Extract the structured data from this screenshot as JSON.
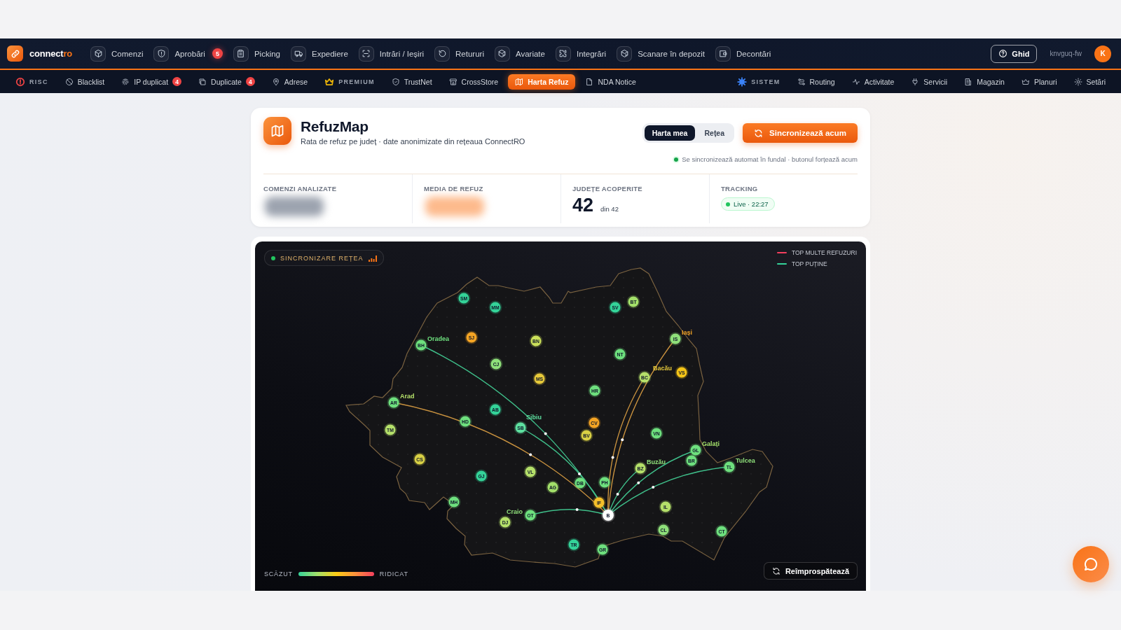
{
  "nav": {
    "brand": {
      "name": "connect",
      "accent": "ro"
    },
    "items": [
      {
        "label": "Comenzi"
      },
      {
        "label": "Aprobări",
        "badge": "5"
      },
      {
        "label": "Picking"
      },
      {
        "label": "Expediere"
      },
      {
        "label": "Intrări / Ieșiri"
      },
      {
        "label": "Retururi"
      },
      {
        "label": "Avariate"
      },
      {
        "label": "Integrări"
      },
      {
        "label": "Scanare în depozit"
      },
      {
        "label": "Decontări"
      }
    ],
    "help": "Ghid",
    "user": "knvguq-fw",
    "avatar": "K"
  },
  "subnav": {
    "left": [
      {
        "label": "RISC",
        "kind": "section",
        "color": "#ef4444"
      },
      {
        "label": "Blacklist",
        "kind": "link",
        "selected": false
      },
      {
        "label": "IP duplicat",
        "kind": "link",
        "badge": "4",
        "selected": false
      },
      {
        "label": "Duplicate",
        "kind": "link",
        "badge": "4",
        "selected": false
      },
      {
        "label": "Adrese",
        "kind": "link",
        "selected": false
      },
      {
        "label": "PREMIUM",
        "kind": "section",
        "color": "#eab308"
      },
      {
        "label": "TrustNet",
        "kind": "link",
        "selected": false
      },
      {
        "label": "CrossStore",
        "kind": "link",
        "selected": false
      },
      {
        "label": "Harta Refuz",
        "kind": "link",
        "selected": true
      },
      {
        "label": "NDA Notice",
        "kind": "link",
        "selected": false
      }
    ],
    "right": [
      {
        "label": "SISTEM",
        "kind": "section",
        "color": "#3b82f6"
      },
      {
        "label": "Routing",
        "kind": "link",
        "selected": false
      },
      {
        "label": "Activitate",
        "kind": "link",
        "selected": false
      },
      {
        "label": "Servicii",
        "kind": "link",
        "selected": false
      },
      {
        "label": "Magazin",
        "kind": "link",
        "selected": false
      },
      {
        "label": "Planuri",
        "kind": "link",
        "selected": false
      },
      {
        "label": "Setări",
        "kind": "link",
        "selected": false
      }
    ]
  },
  "header": {
    "title": "RefuzMap",
    "subtitle": "Rata de refuz pe județ · date anonimizate din rețeaua ConnectRO",
    "view_toggle": [
      {
        "label": "Harta mea",
        "selected": true
      },
      {
        "label": "Rețea",
        "selected": false
      }
    ],
    "sync_button": "Sincronizează acum",
    "sync_note": "Se sincronizează automat în fundal · butonul forțează acum"
  },
  "stats": [
    {
      "label": "COMENZI ANALIZATE",
      "kind": "blurred",
      "color": "#9ca3af"
    },
    {
      "label": "MEDIA DE REFUZ",
      "kind": "blurred",
      "color": "#fdba8c"
    },
    {
      "label": "JUDEȚE ACOPERITE",
      "kind": "number",
      "value": "42",
      "suffix": "din 42"
    },
    {
      "label": "TRACKING",
      "kind": "live",
      "value": "Live · 22:27"
    }
  ],
  "map": {
    "sync_chip": "SINCRONIZARE REȚEA",
    "legend": [
      {
        "label": "TOP MULTE REFUZURI",
        "color": "#f43f5e"
      },
      {
        "label": "TOP PUȚINE",
        "color": "#34d399"
      }
    ],
    "scale": {
      "low": "SCĂZUT",
      "high": "RIDICAT"
    },
    "refresh_button": "Reîmprospătează",
    "counties": [
      {
        "code": "SM",
        "color": "#34d399"
      },
      {
        "code": "MM",
        "color": "#34d399"
      },
      {
        "code": "SV",
        "color": "#34d399"
      },
      {
        "code": "BT",
        "color": "#a3e06a"
      },
      {
        "code": "BH",
        "color": "#6ee07e",
        "route": {
          "color": "#3fbf8a"
        },
        "label": {
          "text": "Oradea",
          "color": "#6ee07e"
        }
      },
      {
        "code": "SJ",
        "color": "#f5a524"
      },
      {
        "code": "BN",
        "color": "#cbe05a"
      },
      {
        "code": "IS",
        "color": "#8fe07a",
        "route": {
          "color": "#c9923f"
        },
        "label": {
          "text": "Iași",
          "color": "#f5a524"
        }
      },
      {
        "code": "CJ",
        "color": "#8fe07a"
      },
      {
        "code": "NT",
        "color": "#6ee07e"
      },
      {
        "code": "MS",
        "color": "#e6c93a"
      },
      {
        "code": "BC",
        "color": "#b5e06a",
        "route": {
          "color": "#c9923f"
        },
        "label": {
          "text": "Bacău",
          "color": "#e6c93a"
        }
      },
      {
        "code": "VS",
        "color": "#f5c518"
      },
      {
        "code": "HR",
        "color": "#6ee07e"
      },
      {
        "code": "AR",
        "color": "#6ee07e",
        "route": {
          "color": "#c9923f"
        },
        "label": {
          "text": "Arad",
          "color": "#b5e06a"
        }
      },
      {
        "code": "AB",
        "color": "#34d399"
      },
      {
        "code": "TM",
        "color": "#b5e06a"
      },
      {
        "code": "HD",
        "color": "#6ee07e"
      },
      {
        "code": "SB",
        "color": "#5ee0a0",
        "route": {
          "color": "#3fbf8a"
        },
        "label": {
          "text": "Sibiu",
          "color": "#5ee0a0"
        }
      },
      {
        "code": "BV",
        "color": "#d8d045"
      },
      {
        "code": "CV",
        "color": "#f5a524"
      },
      {
        "code": "VN",
        "color": "#6ee07e"
      },
      {
        "code": "GL",
        "color": "#6ee07e",
        "route": {
          "color": "#3fbf8a"
        },
        "label": {
          "text": "Galați",
          "color": "#a3e06a"
        }
      },
      {
        "code": "CS",
        "color": "#d8d045"
      },
      {
        "code": "BZ",
        "color": "#b5e06a",
        "route": {
          "color": "#3fbf8a"
        },
        "label": {
          "text": "Buzău",
          "color": "#8fe07a"
        }
      },
      {
        "code": "BR",
        "color": "#6ee07e"
      },
      {
        "code": "TL",
        "color": "#6ee07e",
        "route": {
          "color": "#3fbf8a"
        },
        "label": {
          "text": "Tulcea",
          "color": "#8fe07a"
        }
      },
      {
        "code": "GJ",
        "color": "#34d399"
      },
      {
        "code": "VL",
        "color": "#b5e06a"
      },
      {
        "code": "AG",
        "color": "#a3e06a"
      },
      {
        "code": "DB",
        "color": "#6ee07e"
      },
      {
        "code": "PH",
        "color": "#6ee07e"
      },
      {
        "code": "MH",
        "color": "#6ee07e"
      },
      {
        "code": "IF",
        "color": "#f5c02a"
      },
      {
        "code": "IL",
        "color": "#b5e06a"
      },
      {
        "code": "DJ",
        "color": "#b5e06a",
        "label": {
          "text": "Craio",
          "color": "#8fe07a"
        }
      },
      {
        "code": "OT",
        "color": "#6ee07e",
        "route": {
          "color": "#3fbf8a"
        }
      },
      {
        "code": "B",
        "color": "#ffffff"
      },
      {
        "code": "CL",
        "color": "#8fe07a"
      },
      {
        "code": "CT",
        "color": "#6ee07e"
      },
      {
        "code": "TR",
        "color": "#34d399"
      },
      {
        "code": "GR",
        "color": "#6ee07e"
      }
    ]
  }
}
